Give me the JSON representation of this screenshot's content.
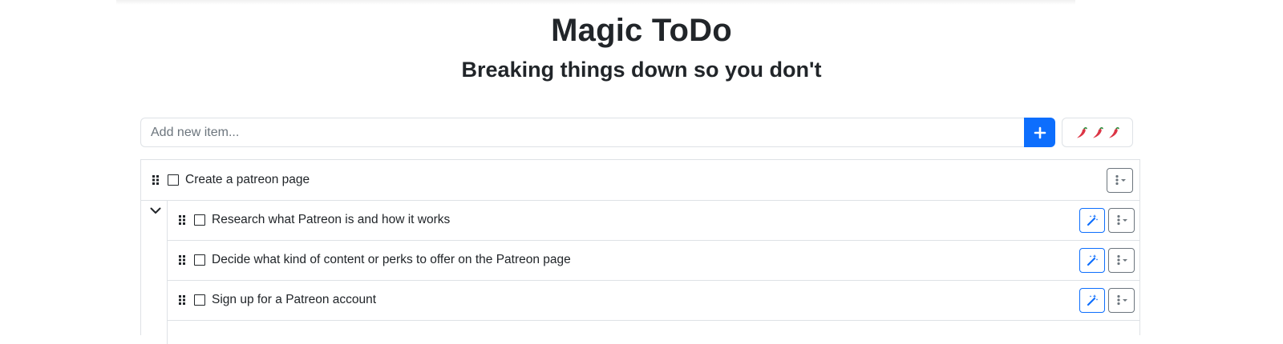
{
  "header": {
    "title": "Magic ToDo",
    "subtitle": "Breaking things down so you don't"
  },
  "add_item": {
    "placeholder": "Add new item...",
    "value": "",
    "add_icon": "plus-icon",
    "spiciness_icon": "chili-pepper-icon",
    "spiciness_level": 3
  },
  "todos": {
    "main": {
      "text": "Create a patreon page",
      "checked": false
    },
    "subtasks": [
      {
        "text": "Research what Patreon is and how it works",
        "checked": false
      },
      {
        "text": "Decide what kind of content or perks to offer on the Patreon page",
        "checked": false
      },
      {
        "text": "Sign up for a Patreon account",
        "checked": false
      }
    ]
  },
  "colors": {
    "primary": "#0d6efd",
    "text": "#212529",
    "border": "#dee2e6",
    "secondary": "#6c757d",
    "chili_red": "#dc3545",
    "chili_green": "#2e8b3a"
  }
}
